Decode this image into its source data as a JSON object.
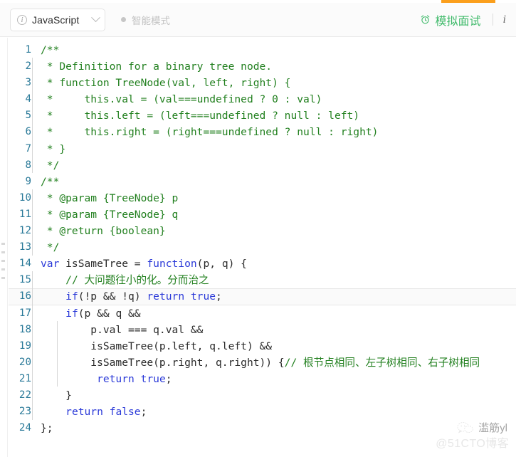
{
  "window": {
    "accent_color": "#fb9f1c",
    "comment_color": "#22801f",
    "keyword_color": "#2a39d8",
    "linenumber_color": "#2b7a99",
    "brand_green": "#3fba6a"
  },
  "toolbar": {
    "language_select": {
      "icon": "info-circle-icon",
      "value": "JavaScript",
      "caret": "chevron-down-icon"
    },
    "smart_mode": {
      "label": "智能模式",
      "indicator": "status-dot-icon"
    },
    "mock_interview": {
      "icon": "alarm-clock-icon",
      "label": "模拟面试"
    },
    "info_button": {
      "label": "i",
      "icon": "info-italic-icon"
    }
  },
  "editor": {
    "active_line": 16,
    "lines": [
      {
        "n": "1",
        "indent": 0,
        "guides": 0,
        "tokens": [
          {
            "t": "cm",
            "s": "/**"
          }
        ]
      },
      {
        "n": "2",
        "indent": 0,
        "guides": 1,
        "tokens": [
          {
            "t": "cm",
            "s": " * Definition for a binary tree node."
          }
        ]
      },
      {
        "n": "3",
        "indent": 0,
        "guides": 1,
        "tokens": [
          {
            "t": "cm",
            "s": " * function TreeNode(val, left, right) {"
          }
        ]
      },
      {
        "n": "4",
        "indent": 0,
        "guides": 1,
        "tokens": [
          {
            "t": "cm",
            "s": " *     this.val = (val===undefined ? 0 : val)"
          }
        ]
      },
      {
        "n": "5",
        "indent": 0,
        "guides": 1,
        "tokens": [
          {
            "t": "cm",
            "s": " *     this.left = (left===undefined ? null : left)"
          }
        ]
      },
      {
        "n": "6",
        "indent": 0,
        "guides": 1,
        "tokens": [
          {
            "t": "cm",
            "s": " *     this.right = (right===undefined ? null : right)"
          }
        ]
      },
      {
        "n": "7",
        "indent": 0,
        "guides": 1,
        "tokens": [
          {
            "t": "cm",
            "s": " * }"
          }
        ]
      },
      {
        "n": "8",
        "indent": 0,
        "guides": 1,
        "tokens": [
          {
            "t": "cm",
            "s": " */"
          }
        ]
      },
      {
        "n": "9",
        "indent": 0,
        "guides": 0,
        "tokens": [
          {
            "t": "cm",
            "s": "/**"
          }
        ]
      },
      {
        "n": "10",
        "indent": 0,
        "guides": 1,
        "tokens": [
          {
            "t": "cm",
            "s": " * @param {TreeNode} p"
          }
        ]
      },
      {
        "n": "11",
        "indent": 0,
        "guides": 1,
        "tokens": [
          {
            "t": "cm",
            "s": " * @param {TreeNode} q"
          }
        ]
      },
      {
        "n": "12",
        "indent": 0,
        "guides": 1,
        "tokens": [
          {
            "t": "cm",
            "s": " * @return {boolean}"
          }
        ]
      },
      {
        "n": "13",
        "indent": 0,
        "guides": 1,
        "tokens": [
          {
            "t": "cm",
            "s": " */"
          }
        ]
      },
      {
        "n": "14",
        "indent": 0,
        "guides": 0,
        "tokens": [
          {
            "t": "kw",
            "s": "var"
          },
          {
            "t": "id",
            "s": " isSameTree = "
          },
          {
            "t": "kw",
            "s": "function"
          },
          {
            "t": "id",
            "s": "(p, q) {"
          }
        ]
      },
      {
        "n": "15",
        "indent": 0,
        "guides": 1,
        "tokens": [
          {
            "t": "id",
            "s": "    "
          },
          {
            "t": "cm",
            "s": "// 大问题往小的化。分而治之"
          }
        ]
      },
      {
        "n": "16",
        "indent": 0,
        "guides": 1,
        "tokens": [
          {
            "t": "id",
            "s": "    "
          },
          {
            "t": "kw",
            "s": "if"
          },
          {
            "t": "id",
            "s": "(!p && !q) "
          },
          {
            "t": "kw",
            "s": "return true"
          },
          {
            "t": "id",
            "s": ";"
          }
        ]
      },
      {
        "n": "17",
        "indent": 0,
        "guides": 1,
        "tokens": [
          {
            "t": "id",
            "s": "    "
          },
          {
            "t": "kw",
            "s": "if"
          },
          {
            "t": "id",
            "s": "(p && q &&"
          }
        ]
      },
      {
        "n": "18",
        "indent": 0,
        "guides": 2,
        "tokens": [
          {
            "t": "id",
            "s": "        p.val === q.val &&"
          }
        ]
      },
      {
        "n": "19",
        "indent": 0,
        "guides": 2,
        "tokens": [
          {
            "t": "id",
            "s": "        isSameTree(p.left, q.left) &&"
          }
        ]
      },
      {
        "n": "20",
        "indent": 0,
        "guides": 2,
        "tokens": [
          {
            "t": "id",
            "s": "        isSameTree(p.right, q.right)) {"
          },
          {
            "t": "cm",
            "s": "// 根节点相同、左子树相同、右子树相同"
          }
        ]
      },
      {
        "n": "21",
        "indent": 0,
        "guides": 2,
        "tokens": [
          {
            "t": "id",
            "s": "         "
          },
          {
            "t": "kw",
            "s": "return true"
          },
          {
            "t": "id",
            "s": ";"
          }
        ]
      },
      {
        "n": "22",
        "indent": 0,
        "guides": 1,
        "tokens": [
          {
            "t": "id",
            "s": "    }"
          }
        ]
      },
      {
        "n": "23",
        "indent": 0,
        "guides": 1,
        "tokens": [
          {
            "t": "id",
            "s": "    "
          },
          {
            "t": "kw",
            "s": "return false"
          },
          {
            "t": "id",
            "s": ";"
          }
        ]
      },
      {
        "n": "24",
        "indent": 0,
        "guides": 0,
        "tokens": [
          {
            "t": "id",
            "s": "};"
          }
        ]
      }
    ]
  },
  "watermark": {
    "icon": "wechat-icon",
    "name": "滥筋yl",
    "source": "@51CTO博客"
  }
}
